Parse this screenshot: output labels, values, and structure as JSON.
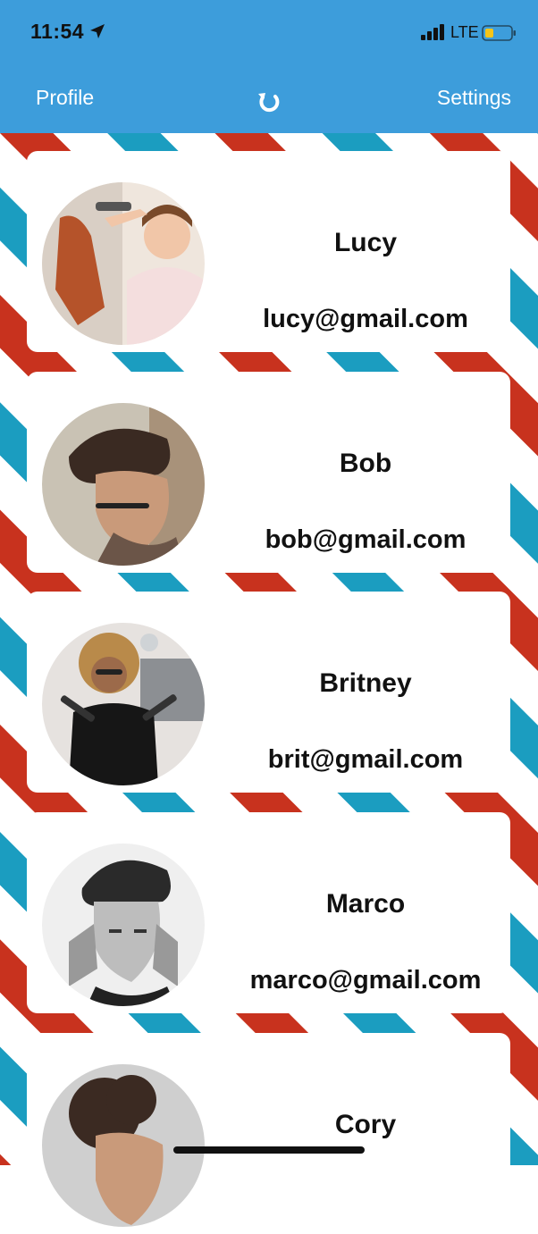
{
  "status_bar": {
    "time": "11:54",
    "network": "LTE",
    "icons": [
      "location-arrow-icon",
      "cellular-signal-icon",
      "battery-icon"
    ]
  },
  "nav": {
    "left_label": "Profile",
    "right_label": "Settings",
    "center_icon": "refresh-icon"
  },
  "colors": {
    "header": "#3d9ddb",
    "stripe_red": "#c8321e",
    "stripe_blue": "#1b9dc0",
    "text": "#111111"
  },
  "contacts": [
    {
      "name": "Lucy",
      "email": "lucy@gmail.com",
      "avatar": "hairdresser-photo"
    },
    {
      "name": "Bob",
      "email": "bob@gmail.com",
      "avatar": "man-with-glasses-photo"
    },
    {
      "name": "Britney",
      "email": "brit@gmail.com",
      "avatar": "stylist-with-irons-photo"
    },
    {
      "name": "Marco",
      "email": "marco@gmail.com",
      "avatar": "man-portrait-bw-photo"
    },
    {
      "name": "Cory",
      "email": "",
      "avatar": "curly-hair-man-photo"
    }
  ]
}
